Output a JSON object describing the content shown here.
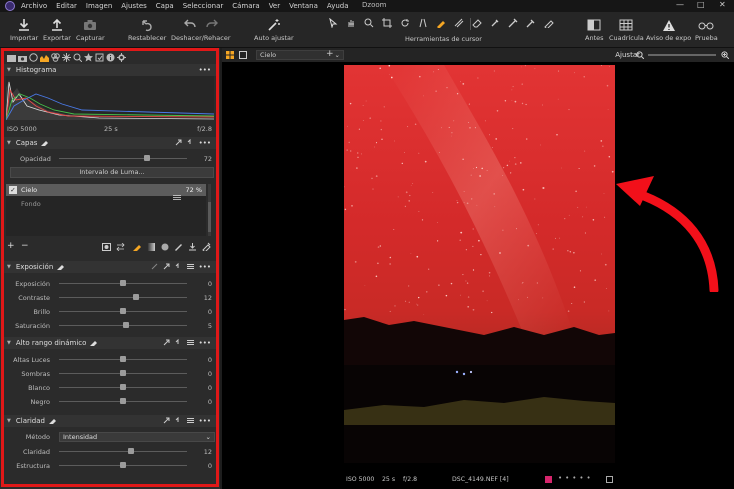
{
  "menubar": {
    "items": [
      "Archivo",
      "Editar",
      "Imagen",
      "Ajustes",
      "Capa",
      "Seleccionar",
      "Cámara",
      "Ver",
      "Ventana",
      "Ayuda"
    ],
    "app_title": "Dzoom",
    "window_controls": [
      "—",
      "□",
      "✕"
    ]
  },
  "toolbar": {
    "import_label": "Importar",
    "export_label": "Exportar",
    "capture_label": "Capturar",
    "reset_label": "Restablecer",
    "undo_redo_label": "Deshacer/Rehacer",
    "auto_adjust_label": "Auto ajustar",
    "cursor_tools_label": "Herramientas de cursor",
    "before_label": "Antes",
    "grid_label": "Cuadrícula",
    "exposure_warning_label": "Aviso de expo",
    "proof_label": "Prueba"
  },
  "colors": {
    "accent": "#f5a623",
    "frame": "#e01818",
    "photo_sky": "#e23434"
  },
  "histogram": {
    "title": "Histograma",
    "iso": "ISO 5000",
    "shutter": "25 s",
    "aperture": "f/2.8"
  },
  "layers": {
    "title": "Capas",
    "opacity_label": "Opacidad",
    "opacity_value": "72",
    "opacity_fraction": 0.72,
    "luma_button": "Intervalo de Luma...",
    "items": [
      {
        "name": "Cielo",
        "value": "72 %",
        "selected": true
      },
      {
        "name": "Fondo",
        "selected": false
      }
    ]
  },
  "exposure": {
    "title": "Exposición",
    "rows": [
      {
        "label": "Exposición",
        "value": "0",
        "pos": 0.5
      },
      {
        "label": "Contraste",
        "value": "12",
        "pos": 0.6
      },
      {
        "label": "Brillo",
        "value": "0",
        "pos": 0.5
      },
      {
        "label": "Saturación",
        "value": "5",
        "pos": 0.52
      }
    ]
  },
  "hdr": {
    "title": "Alto rango dinámico",
    "rows": [
      {
        "label": "Altas Luces",
        "value": "0",
        "pos": 0.5
      },
      {
        "label": "Sombras",
        "value": "0",
        "pos": 0.5
      },
      {
        "label": "Blanco",
        "value": "0",
        "pos": 0.5
      },
      {
        "label": "Negro",
        "value": "0",
        "pos": 0.5
      }
    ]
  },
  "clarity": {
    "title": "Claridad",
    "method_label": "Método",
    "method_value": "Intensidad",
    "rows": [
      {
        "label": "Claridad",
        "value": "12",
        "pos": 0.56
      },
      {
        "label": "Estructura",
        "value": "0",
        "pos": 0.5
      }
    ]
  },
  "viewer": {
    "layer_select": "Cielo",
    "adjust_label": "Ajustar",
    "status": {
      "iso": "ISO 5000",
      "shutter": "25 s",
      "aperture": "f/2.8",
      "filename": "DSC_4149.NEF [4]"
    }
  }
}
